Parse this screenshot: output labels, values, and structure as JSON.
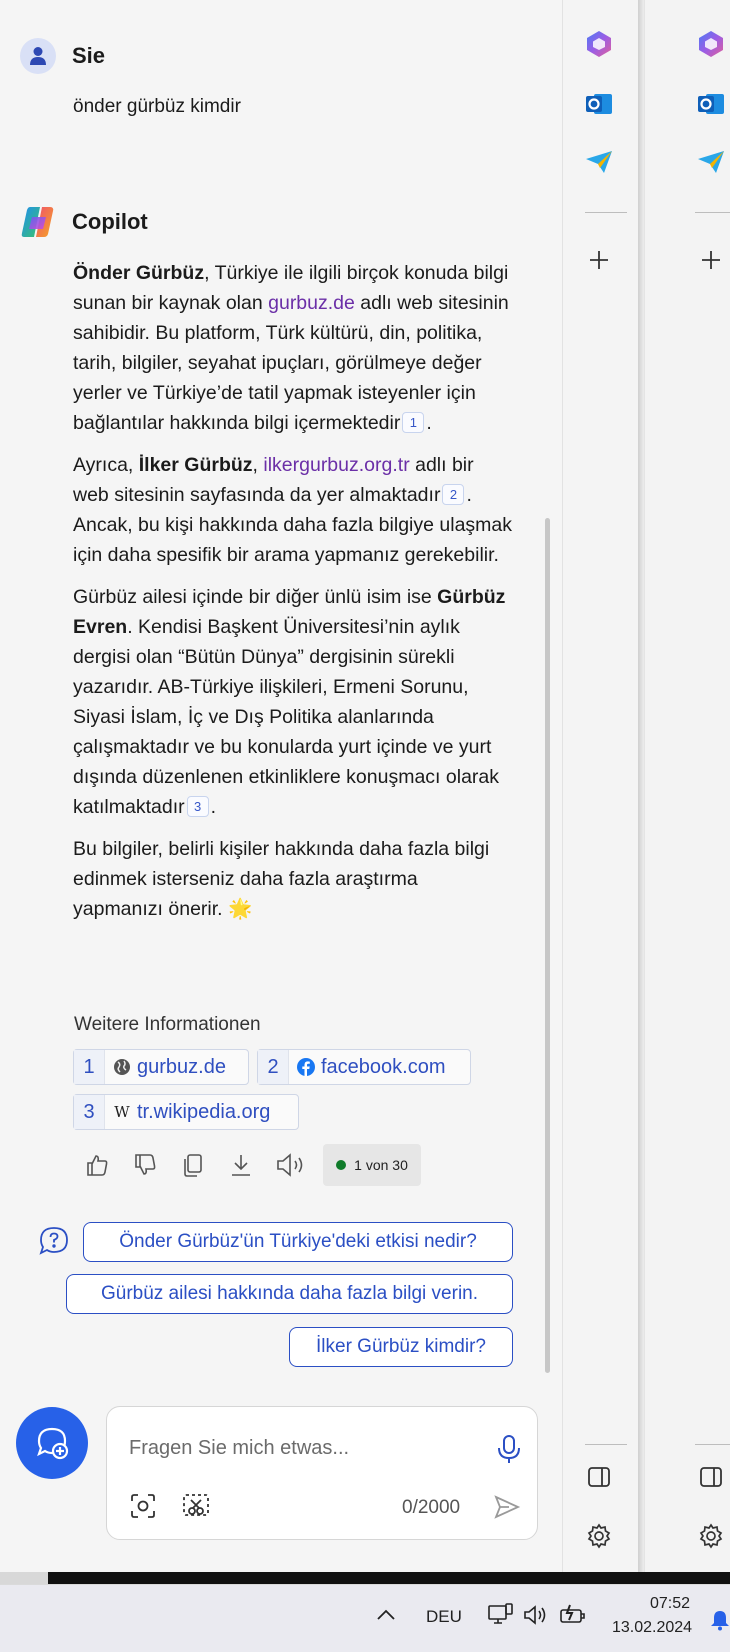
{
  "user": {
    "name": "Sie",
    "message": "önder gürbüz kimdir"
  },
  "assistant": {
    "name": "Copilot",
    "p1": {
      "bold": "Önder Gürbüz",
      "t1": ", Türkiye ile ilgili birçok konuda bilgi sunan bir kaynak olan ",
      "link": "gurbuz.de",
      "t2": " adlı web sitesinin sahibidir. Bu platform, Türk kültürü, din, politika, tarih, bilgiler, seyahat ipuçları, görülmeye değer yerler ve Türkiye’de tatil yapmak isteyenler için bağlantılar hakkında bilgi içermektedir",
      "cite": "1",
      "end": "."
    },
    "p2": {
      "t0": "Ayrıca, ",
      "bold": "İlker Gürbüz",
      "t1": ", ",
      "link": "ilkergurbuz.org.tr",
      "t2": " adlı bir web sitesinin sayfasında da yer almaktadır",
      "cite": "2",
      "t3": ". Ancak, bu kişi hakkında daha fazla bilgiye ulaşmak için daha spesifik bir arama yapmanız gerekebilir."
    },
    "p3": {
      "t0": "Gürbüz ailesi içinde bir diğer ünlü isim ise ",
      "bold": "Gürbüz Evren",
      "t1": ". Kendisi Başkent Üniversitesi’nin aylık dergisi olan “Bütün Dünya” dergisinin sürekli yazarıdır. AB-Türkiye ilişkileri, Ermeni Sorunu, Siyasi İslam, İç ve Dış Politika alanlarında çalışmaktadır ve bu konularda yurt içinde ve yurt dışında düzenlenen etkinliklere konuşmacı olarak katılmaktadır",
      "cite": "3",
      "end": "."
    },
    "p4": "Bu bilgiler, belirli kişiler hakkında daha fazla bilgi edinmek isterseniz daha fazla araştırma yapmanızı önerir. 🌟"
  },
  "sources": {
    "label": "Weitere Informationen",
    "items": [
      {
        "num": "1",
        "text": "gurbuz.de",
        "icon": "globe-icon"
      },
      {
        "num": "2",
        "text": "facebook.com",
        "icon": "facebook-icon"
      },
      {
        "num": "3",
        "text": "tr.wikipedia.org",
        "icon": "wikipedia-icon"
      }
    ]
  },
  "response_counter": "1 von 30",
  "suggestions": [
    "Önder Gürbüz'ün Türkiye'deki etkisi nedir?",
    "Gürbüz ailesi hakkında daha fazla bilgi verin.",
    "İlker Gürbüz kimdir?"
  ],
  "input": {
    "placeholder": "Fragen Sie mich etwas...",
    "char_count": "0/2000"
  },
  "taskbar": {
    "language": "DEU",
    "time": "07:52",
    "date": "13.02.2024"
  },
  "colors": {
    "accent": "#2761e8",
    "link": "#6b2fa7",
    "suggestion": "#2b4fc4",
    "status_dot": "#0f7b2a"
  }
}
